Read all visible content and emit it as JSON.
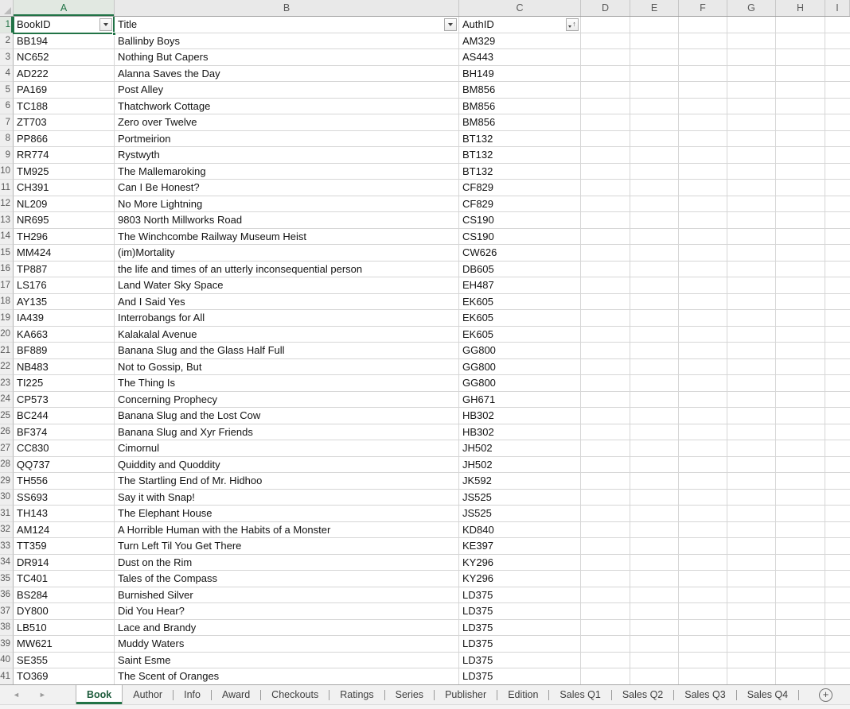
{
  "colors": {
    "accent_green": "#217346",
    "grid_line": "#d6d6d6",
    "header_bg": "#e9e9e9",
    "selected_header_bg": "#e1e8e1",
    "tab_strip_bg": "#f1f1f1",
    "active_tab_bg": "#ffffff"
  },
  "icons": {
    "filter_chevron": "filter-dropdown-triangle",
    "sort_asc_arrow": "↑",
    "nav_left": "◄",
    "nav_right": "►",
    "new_sheet": "+"
  },
  "sheet": {
    "columns": [
      {
        "letter": "A",
        "selected": true
      },
      {
        "letter": "B"
      },
      {
        "letter": "C"
      },
      {
        "letter": "D"
      },
      {
        "letter": "E"
      },
      {
        "letter": "F"
      },
      {
        "letter": "G"
      },
      {
        "letter": "H"
      },
      {
        "letter": "I"
      }
    ],
    "header_row": {
      "number": "1",
      "book_id": "BookID",
      "title": "Title",
      "auth_id": "AuthID"
    },
    "rows": [
      {
        "n": 2,
        "book_id": "BB194",
        "title": "Ballinby Boys",
        "auth_id": "AM329"
      },
      {
        "n": 3,
        "book_id": "NC652",
        "title": "Nothing But Capers",
        "auth_id": "AS443"
      },
      {
        "n": 4,
        "book_id": "AD222",
        "title": "Alanna Saves the Day",
        "auth_id": "BH149"
      },
      {
        "n": 5,
        "book_id": "PA169",
        "title": "Post Alley",
        "auth_id": "BM856"
      },
      {
        "n": 6,
        "book_id": "TC188",
        "title": "Thatchwork Cottage",
        "auth_id": "BM856"
      },
      {
        "n": 7,
        "book_id": "ZT703",
        "title": "Zero over Twelve",
        "auth_id": "BM856"
      },
      {
        "n": 8,
        "book_id": "PP866",
        "title": "Portmeirion",
        "auth_id": "BT132"
      },
      {
        "n": 9,
        "book_id": "RR774",
        "title": "Rystwyth",
        "auth_id": "BT132"
      },
      {
        "n": 10,
        "book_id": "TM925",
        "title": "The Mallemaroking",
        "auth_id": "BT132"
      },
      {
        "n": 11,
        "book_id": "CH391",
        "title": "Can I Be Honest?",
        "auth_id": "CF829"
      },
      {
        "n": 12,
        "book_id": "NL209",
        "title": "No More Lightning",
        "auth_id": "CF829"
      },
      {
        "n": 13,
        "book_id": "NR695",
        "title": "9803 North Millworks Road",
        "auth_id": "CS190"
      },
      {
        "n": 14,
        "book_id": "TH296",
        "title": "The Winchcombe Railway Museum Heist",
        "auth_id": "CS190"
      },
      {
        "n": 15,
        "book_id": "MM424",
        "title": "(im)Mortality",
        "auth_id": "CW626"
      },
      {
        "n": 16,
        "book_id": "TP887",
        "title": "the life and times of an utterly inconsequential person",
        "auth_id": "DB605"
      },
      {
        "n": 17,
        "book_id": "LS176",
        "title": "Land Water Sky Space",
        "auth_id": "EH487"
      },
      {
        "n": 18,
        "book_id": "AY135",
        "title": "And I Said Yes",
        "auth_id": "EK605"
      },
      {
        "n": 19,
        "book_id": "IA439",
        "title": "Interrobangs for All",
        "auth_id": "EK605"
      },
      {
        "n": 20,
        "book_id": "KA663",
        "title": "Kalakalal Avenue",
        "auth_id": "EK605"
      },
      {
        "n": 21,
        "book_id": "BF889",
        "title": "Banana Slug and the Glass Half Full",
        "auth_id": "GG800"
      },
      {
        "n": 22,
        "book_id": "NB483",
        "title": "Not to Gossip, But",
        "auth_id": "GG800"
      },
      {
        "n": 23,
        "book_id": "TI225",
        "title": "The Thing Is",
        "auth_id": "GG800"
      },
      {
        "n": 24,
        "book_id": "CP573",
        "title": "Concerning Prophecy",
        "auth_id": "GH671"
      },
      {
        "n": 25,
        "book_id": "BC244",
        "title": "Banana Slug and the Lost Cow",
        "auth_id": "HB302"
      },
      {
        "n": 26,
        "book_id": "BF374",
        "title": "Banana Slug and Xyr Friends",
        "auth_id": "HB302"
      },
      {
        "n": 27,
        "book_id": "CC830",
        "title": "Cimornul",
        "auth_id": "JH502"
      },
      {
        "n": 28,
        "book_id": "QQ737",
        "title": "Quiddity and Quoddity",
        "auth_id": "JH502"
      },
      {
        "n": 29,
        "book_id": "TH556",
        "title": "The Startling End of Mr. Hidhoo",
        "auth_id": "JK592"
      },
      {
        "n": 30,
        "book_id": "SS693",
        "title": "Say it with Snap!",
        "auth_id": "JS525"
      },
      {
        "n": 31,
        "book_id": "TH143",
        "title": "The Elephant House",
        "auth_id": "JS525"
      },
      {
        "n": 32,
        "book_id": "AM124",
        "title": "A Horrible Human with the Habits of a Monster",
        "auth_id": "KD840"
      },
      {
        "n": 33,
        "book_id": "TT359",
        "title": "Turn Left Til You Get There",
        "auth_id": "KE397"
      },
      {
        "n": 34,
        "book_id": "DR914",
        "title": "Dust on the Rim",
        "auth_id": "KY296"
      },
      {
        "n": 35,
        "book_id": "TC401",
        "title": "Tales of the Compass",
        "auth_id": "KY296"
      },
      {
        "n": 36,
        "book_id": "BS284",
        "title": "Burnished Silver",
        "auth_id": "LD375"
      },
      {
        "n": 37,
        "book_id": "DY800",
        "title": "Did You Hear?",
        "auth_id": "LD375"
      },
      {
        "n": 38,
        "book_id": "LB510",
        "title": "Lace and Brandy",
        "auth_id": "LD375"
      },
      {
        "n": 39,
        "book_id": "MW621",
        "title": "Muddy Waters",
        "auth_id": "LD375"
      },
      {
        "n": 40,
        "book_id": "SE355",
        "title": "Saint Esme",
        "auth_id": "LD375"
      },
      {
        "n": 41,
        "book_id": "TO369",
        "title": "The Scent of Oranges",
        "auth_id": "LD375"
      }
    ]
  },
  "tab_bar": {
    "tabs": [
      {
        "label": "Book",
        "active": true
      },
      {
        "label": "Author"
      },
      {
        "label": "Info"
      },
      {
        "label": "Award"
      },
      {
        "label": "Checkouts"
      },
      {
        "label": "Ratings"
      },
      {
        "label": "Series"
      },
      {
        "label": "Publisher"
      },
      {
        "label": "Edition"
      },
      {
        "label": "Sales Q1"
      },
      {
        "label": "Sales Q2"
      },
      {
        "label": "Sales Q3"
      },
      {
        "label": "Sales Q4"
      }
    ]
  }
}
